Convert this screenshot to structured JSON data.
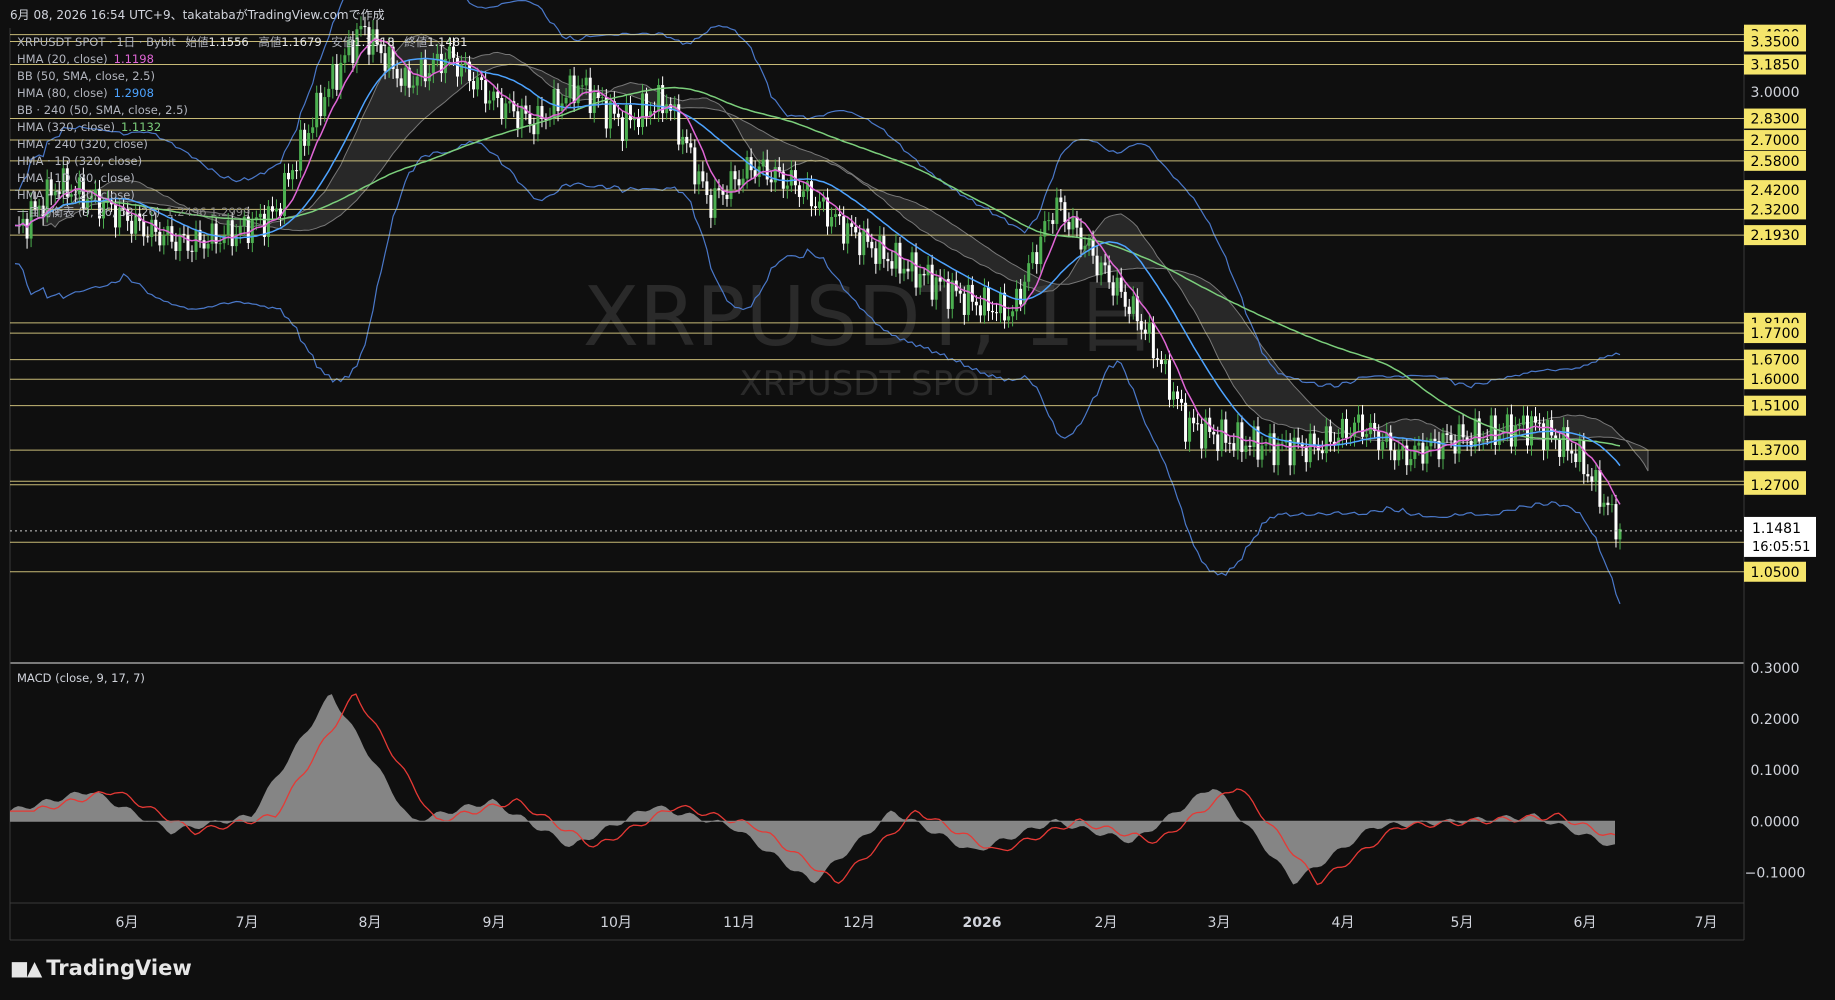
{
  "header": {
    "text": "6月 08, 2026 16:54 UTC+9、takatabaがTradingView.comで作成"
  },
  "symbol_line": {
    "symbol": "XRPUSDT SPOT · 1日 · Bybit",
    "open_label": "始値",
    "open": "1.1556",
    "high_label": "高値",
    "high": "1.1679",
    "low_label": "安値",
    "low": "1.1318",
    "close_label": "終値",
    "close": "1.1481"
  },
  "indicators": [
    {
      "label": "HMA (20, close)",
      "value": "1.1198",
      "color": "#e066d6"
    },
    {
      "label": "BB (50, SMA, close, 2.5)",
      "value": "",
      "color": "#4a90e2"
    },
    {
      "label": "HMA (80, close)",
      "value": "1.2908",
      "color": "#4da3ff"
    },
    {
      "label": "BB · 240 (50, SMA, close, 2.5)",
      "value": "",
      "color": "#4a90e2"
    },
    {
      "label": "HMA (320, close)",
      "value": "1.1132",
      "color": "#7ccf7c"
    },
    {
      "label": "HMA · 240 (320, close)",
      "value": "",
      "color": "#888888"
    },
    {
      "label": "HMA · 1D (320, close)",
      "value": "",
      "color": "#888888"
    },
    {
      "label": "HMA · 1D (80, close)",
      "value": "",
      "color": "#888888"
    },
    {
      "label": "HMA · 1D (20, close)",
      "value": "",
      "color": "#888888"
    },
    {
      "label": "一目均衡表 (9, 26, 52, 26)",
      "value": "1.2496  1.2999",
      "color": "#888888"
    }
  ],
  "watermark": {
    "big": "XRPUSDT, 1日",
    "small": "XRPUSDT SPOT"
  },
  "colors": {
    "background": "#0f0f0f",
    "up": "#4caf50",
    "down": "#ffffff",
    "hline": "#e8d88a",
    "label_bg": "#f5e56b",
    "hma20": "#e066d6",
    "hma80": "#4da3ff",
    "hma320": "#7ccf7c",
    "bb": "#4a78c9",
    "cloud": "#5a5a5a",
    "macd_hist": "#9a9a9a",
    "macd_signal": "#e53935"
  },
  "horizontal_levels": [
    "3.4000",
    "3.3500",
    "3.1850",
    "2.8300",
    "2.7000",
    "2.5800",
    "2.4200",
    "2.3200",
    "2.1930",
    "1.8100",
    "1.7700",
    "1.6700",
    "1.6000",
    "1.5100",
    "1.3700",
    "1.2800",
    "1.2700",
    "1.1200",
    "1.0500"
  ],
  "price_axis_ticks": [
    "3.0000"
  ],
  "current_price": {
    "price": "1.1481",
    "countdown": "16:05:51"
  },
  "macd": {
    "title": "MACD (close, 9, 17, 7)",
    "ticks": [
      "0.3000",
      "0.2000",
      "0.1000",
      "0.0000",
      "−0.1000"
    ]
  },
  "time_axis": [
    "6月",
    "7月",
    "8月",
    "9月",
    "10月",
    "11月",
    "12月",
    "2026",
    "2月",
    "3月",
    "4月",
    "5月",
    "6月",
    "7月"
  ],
  "chart_data": {
    "type": "candlestick",
    "title": "XRPUSDT SPOT · 1日 · Bybit",
    "y_range_main": [
      0.86,
      3.45
    ],
    "y_scale": "log",
    "y_range_macd": [
      -0.16,
      0.31
    ],
    "price_path": [
      {
        "x": "5月上旬",
        "y": 2.2
      },
      {
        "x": "5月中旬",
        "y": 2.45
      },
      {
        "x": "5月下旬",
        "y": 2.35
      },
      {
        "x": "6月",
        "y": 2.22
      },
      {
        "x": "6月下旬",
        "y": 2.15
      },
      {
        "x": "7月",
        "y": 2.2
      },
      {
        "x": "7月上旬",
        "y": 2.3
      },
      {
        "x": "7月中旬",
        "y": 2.9
      },
      {
        "x": "7月下旬",
        "y": 3.45
      },
      {
        "x": "8月",
        "y": 3.05
      },
      {
        "x": "8月中旬",
        "y": 3.25
      },
      {
        "x": "8月下旬",
        "y": 2.95
      },
      {
        "x": "9月",
        "y": 2.8
      },
      {
        "x": "9月中旬",
        "y": 3.05
      },
      {
        "x": "9月下旬",
        "y": 2.8
      },
      {
        "x": "10月",
        "y": 2.95
      },
      {
        "x": "10月中旬",
        "y": 2.35
      },
      {
        "x": "10月下旬",
        "y": 2.55
      },
      {
        "x": "11月",
        "y": 2.45
      },
      {
        "x": "11月中旬",
        "y": 2.25
      },
      {
        "x": "11月下旬",
        "y": 2.1
      },
      {
        "x": "12月",
        "y": 2.0
      },
      {
        "x": "12月中旬",
        "y": 1.9
      },
      {
        "x": "12月下旬",
        "y": 1.85
      },
      {
        "x": "2026",
        "y": 2.35
      },
      {
        "x": "1月中旬",
        "y": 2.05
      },
      {
        "x": "1月下旬",
        "y": 1.8
      },
      {
        "x": "2月",
        "y": 1.45
      },
      {
        "x": "2月上旬",
        "y": 1.4
      },
      {
        "x": "2月中旬",
        "y": 1.38
      },
      {
        "x": "3月",
        "y": 1.38
      },
      {
        "x": "3月中旬",
        "y": 1.45
      },
      {
        "x": "4月",
        "y": 1.35
      },
      {
        "x": "4月中旬",
        "y": 1.4
      },
      {
        "x": "5月",
        "y": 1.42
      },
      {
        "x": "5月中旬",
        "y": 1.45
      },
      {
        "x": "6月",
        "y": 1.36
      },
      {
        "x": "6月08",
        "y": 1.1481
      }
    ],
    "macd_path": [
      {
        "x": "5月上旬",
        "y": 0.02
      },
      {
        "x": "5月中旬",
        "y": 0.06
      },
      {
        "x": "6月",
        "y": -0.02
      },
      {
        "x": "7月",
        "y": 0.01
      },
      {
        "x": "7月下旬",
        "y": 0.25
      },
      {
        "x": "8月",
        "y": 0.0
      },
      {
        "x": "8月中旬",
        "y": 0.04
      },
      {
        "x": "9月",
        "y": -0.05
      },
      {
        "x": "9月中旬",
        "y": 0.03
      },
      {
        "x": "10月",
        "y": -0.01
      },
      {
        "x": "10月中旬",
        "y": -0.12
      },
      {
        "x": "11月",
        "y": 0.02
      },
      {
        "x": "11月中旬",
        "y": -0.06
      },
      {
        "x": "12月",
        "y": 0.0
      },
      {
        "x": "12月下旬",
        "y": -0.04
      },
      {
        "x": "2026",
        "y": 0.07
      },
      {
        "x": "2月",
        "y": -0.12
      },
      {
        "x": "3月",
        "y": -0.01
      },
      {
        "x": "4月",
        "y": 0.0
      },
      {
        "x": "5月",
        "y": 0.01
      },
      {
        "x": "6月",
        "y": -0.05
      }
    ]
  }
}
